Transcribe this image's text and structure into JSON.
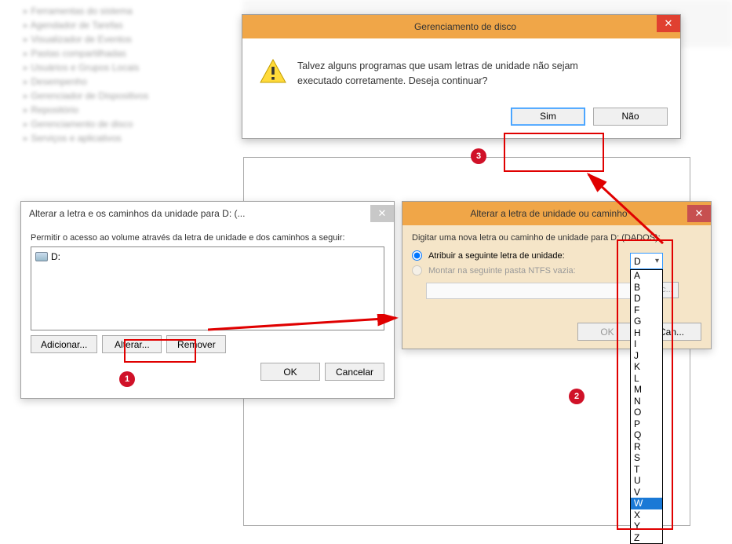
{
  "tree_items": [
    "Ferramentas do sistema",
    "Agendador de Tarefas",
    "Visualizador de Eventos",
    "Pastas compartilhadas",
    "Usuários e Grupos Locais",
    "Desempenho",
    "Gerenciador de Dispositivos",
    "Repositório",
    "Gerenciamento de disco",
    "Serviços e aplicativos"
  ],
  "dialog1": {
    "title": "Alterar a letra e os caminhos da unidade para D: (...",
    "label": "Permitir o acesso ao volume através da letra de unidade e dos caminhos a seguir:",
    "item": "D:",
    "add": "Adicionar...",
    "change": "Alterar...",
    "remove": "Remover",
    "ok": "OK",
    "cancel": "Cancelar"
  },
  "dialog2": {
    "title": "Alterar a letra de unidade ou caminho",
    "label": "Digitar uma nova letra ou caminho de unidade para D: (DADOS):",
    "opt1": "Atribuir a seguinte letra de unidade:",
    "opt2": "Montar na seguinte pasta NTFS vazia:",
    "browse": "Procurar...",
    "ok": "OK",
    "cancel": "Cancelar",
    "selected_letter": "D",
    "letters": [
      "A",
      "B",
      "D",
      "F",
      "G",
      "H",
      "I",
      "J",
      "K",
      "L",
      "M",
      "N",
      "O",
      "P",
      "Q",
      "R",
      "S",
      "T",
      "U",
      "V",
      "W",
      "X",
      "Y",
      "Z"
    ],
    "highlighted_letter": "W"
  },
  "dialog3": {
    "title": "Gerenciamento de disco",
    "msg_line1": "Talvez alguns programas que usam letras de unidade não sejam",
    "msg_line2": "executado corretamente. Deseja continuar?",
    "yes": "Sim",
    "no": "Não"
  },
  "annotations": {
    "n1": "1",
    "n2": "2",
    "n3": "3"
  }
}
